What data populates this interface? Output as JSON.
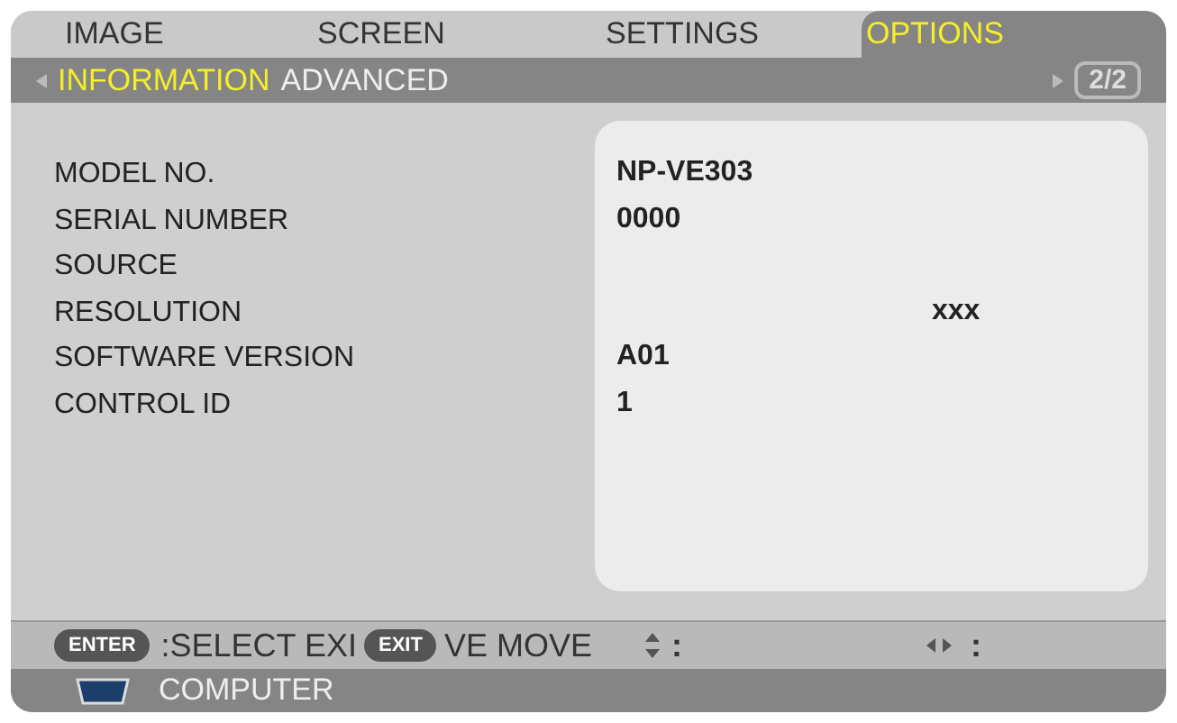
{
  "tabs": [
    {
      "label": "IMAGE",
      "selected": false
    },
    {
      "label": "SCREEN",
      "selected": false
    },
    {
      "label": "SETTINGS",
      "selected": false
    },
    {
      "label": "OPTIONS",
      "selected": true
    }
  ],
  "subtabs": [
    {
      "label": "INFORMATION",
      "selected": true
    },
    {
      "label": "ADVANCED",
      "selected": false
    }
  ],
  "page_indicator": "2/2",
  "info": [
    {
      "label": "MODEL NO.",
      "value": "NP-VE303"
    },
    {
      "label": "SERIAL NUMBER",
      "value": "0000"
    },
    {
      "label": "SOURCE"
    },
    {
      "label": "RESOLUTION",
      "value": "xxx"
    },
    {
      "label": "SOFTWARE VERSION",
      "value": "A01"
    },
    {
      "label": "CONTROL ID",
      "value": "1"
    }
  ],
  "help_bar": {
    "enter_key": "ENTER",
    "select_text": ":SELECT EXI",
    "exit_key": "EXIT",
    "move_text": "VE MOVE",
    "updown_text": ":",
    "leftright_text": ":"
  },
  "status_bar": {
    "source": "COMPUTER"
  }
}
